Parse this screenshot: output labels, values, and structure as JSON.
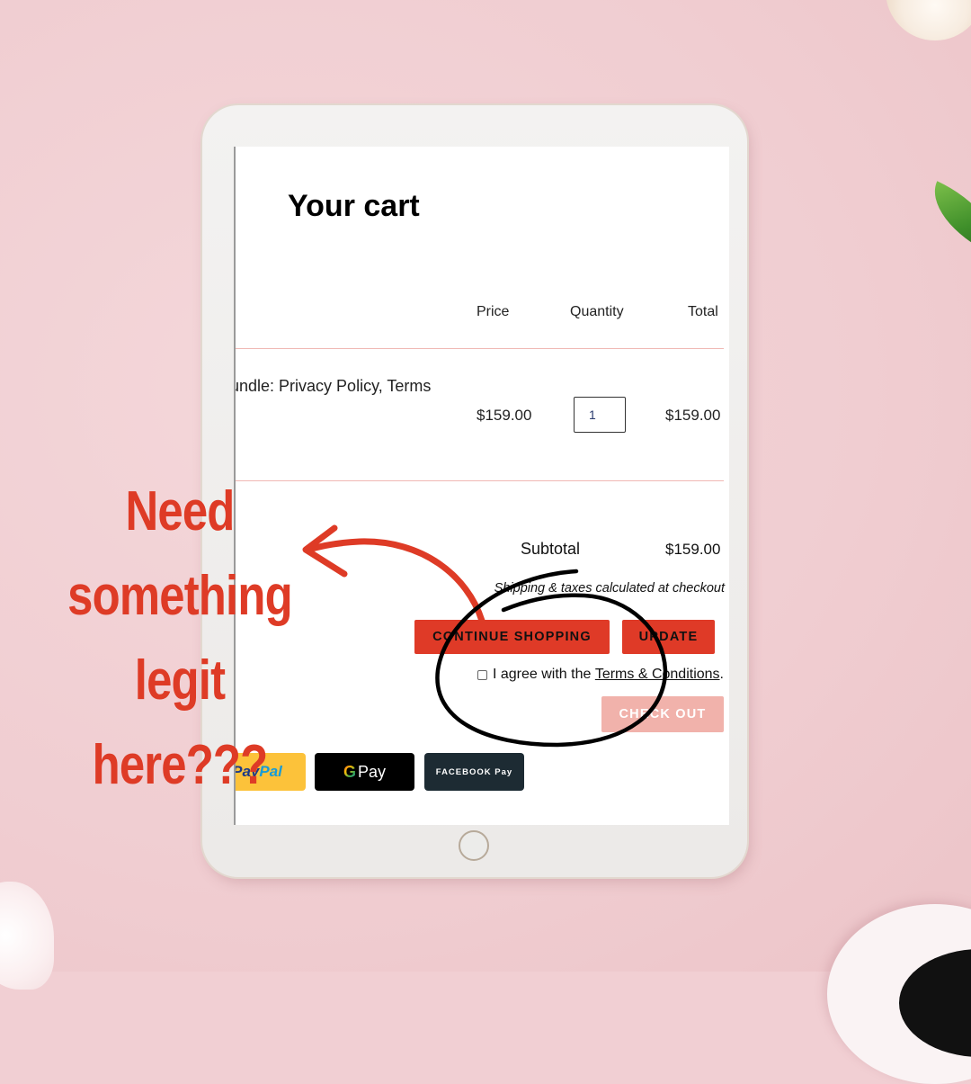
{
  "cart": {
    "title": "Your cart",
    "columns": {
      "price": "Price",
      "quantity": "Quantity",
      "total": "Total"
    },
    "items": [
      {
        "name": "undle: Privacy Policy, Terms",
        "price": "$159.00",
        "quantity": "1",
        "total": "$159.00"
      }
    ],
    "subtotal_label": "Subtotal",
    "subtotal_value": "$159.00",
    "shipping_note": "Shipping & taxes calculated at checkout",
    "continue_label": "CONTINUE SHOPPING",
    "update_label": "UPDATE",
    "agree_text": "I agree with the ",
    "terms_link": "Terms & Conditions",
    "agree_end": ".",
    "checkout_label": "CHECK OUT",
    "payment_methods": {
      "paypal_a": "Pay",
      "paypal_b": "Pal",
      "gpay_g": "G",
      "gpay_text": "Pay",
      "facebook": "FACEBOOK Pay"
    }
  },
  "annotation": {
    "lines": [
      "Need",
      "something",
      "legit here???"
    ]
  },
  "colors": {
    "accent_red": "#df3a27",
    "checkout_disabled": "#f1b2ab",
    "background_pink": "#f1cfd3"
  }
}
